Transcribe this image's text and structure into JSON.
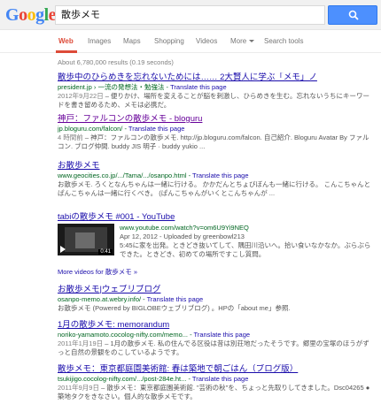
{
  "header": {
    "logo_letters": [
      {
        "ch": "G",
        "color": "#4285f4"
      },
      {
        "ch": "o",
        "color": "#ea4335"
      },
      {
        "ch": "o",
        "color": "#fbbc05"
      },
      {
        "ch": "g",
        "color": "#4285f4"
      },
      {
        "ch": "l",
        "color": "#34a853"
      },
      {
        "ch": "e",
        "color": "#ea4335"
      }
    ],
    "query": "散歩メモ",
    "search_button_icon": "magnifier-icon"
  },
  "tabs": [
    {
      "label": "Web",
      "active": true
    },
    {
      "label": "Images"
    },
    {
      "label": "Maps"
    },
    {
      "label": "Shopping"
    },
    {
      "label": "Videos"
    },
    {
      "label": "More"
    },
    {
      "label": "Search tools"
    }
  ],
  "stats": "About 6,780,000 results (0.19 seconds)",
  "results": [
    {
      "title": "散歩中のひらめきを忘れないためには…… 2大賢人に学ぶ「メモ」ノ",
      "url": "president.jp › 一流の発想法・勉強法",
      "translate": "Translate this page",
      "snippet_date": "2012年9月22日",
      "snippet": " – 便りかけ、場所を変えることが脳を刺激し、ひらめきを生む。忘れないうちにキーワードを書き留めるため、メモは必携だ。"
    },
    {
      "title": "神戸：ファルコンの散歩メモ - bloguru",
      "url": "jp.bloguru.com/falcon/",
      "translate": "Translate this page",
      "snippet_date": "4 時間前",
      "snippet": " – 神戸：ファルコンの散歩メモ. http://jp.bloguru.com/falcon. 自己紹介. Bloguru Avatar By ファルコン. ブログ仲間. buddy JIS 明子 · buddy yukio ..."
    },
    {
      "title": "お散歩メモ",
      "url": "www.geocities.co.jp/.../Tama/.../osanpo.html",
      "translate": "Translate this page",
      "snippet_date": "",
      "snippet": "お散歩メモ. ろくとなんちゃんは一緒に行ける。 かかだんとちょびぼんも一緒に行ける。 こんこちゃんとぱんこちゃんは一緒に行くべき。 (ぱんこちゃんがいくとこんちゃんが ..."
    }
  ],
  "video": {
    "title": "tabiの散歩メモ #001 - YouTube",
    "url": "www.youtube.com/watch?v=om6U9Yi9NEQ",
    "meta": "Apr 12, 2012 - Uploaded by greenbowl213",
    "snippet": "5:45に家を出発。ときどき抜いてして、隅田川沿いへ。拾い食いなかなか。ぶらぶらできた。ときどき、初めての場所ですこし質問。",
    "duration": "0:41",
    "more_videos": "More videos for 散歩メモ »"
  },
  "results2": [
    {
      "title": "お散歩メモ|ウェブリブログ",
      "url": "osanpo-memo.at.webry.info/",
      "translate": "Translate this page",
      "snippet_date": "",
      "snippet": "お散歩メモ (Powered by BIGLOBEウェブリブログ) 。HPの「about me」参照."
    },
    {
      "title": "1月の散歩メモ: memorandum",
      "url": "noriko-yamamoto.cocolog-nifty.com/memo...",
      "translate": "Translate this page",
      "snippet_date": "2011年1月19日",
      "snippet": " – 1月の散歩メモ. 私の住んでる区役は昔は別荘地だったそうです。郷里の宝塚のほうがずっと自然の景観をのこしているようです。"
    },
    {
      "title": "散歩メモ：東京都庭園美術館: 春は築地で朝ごはん（ブログ版）",
      "url": "tsukijigo.cocolog-nifty.com/.../post-284e.ht...",
      "translate": "Translate this page",
      "snippet_date": "2011年9月9日",
      "snippet": " – 散歩メモ：東京都庭園美術館. \"芸術の秋\"を、ちょっと先取りしてきました。Dsc04265 ● 築地タクをきなさい。個人的な散歩メモです。"
    }
  ]
}
